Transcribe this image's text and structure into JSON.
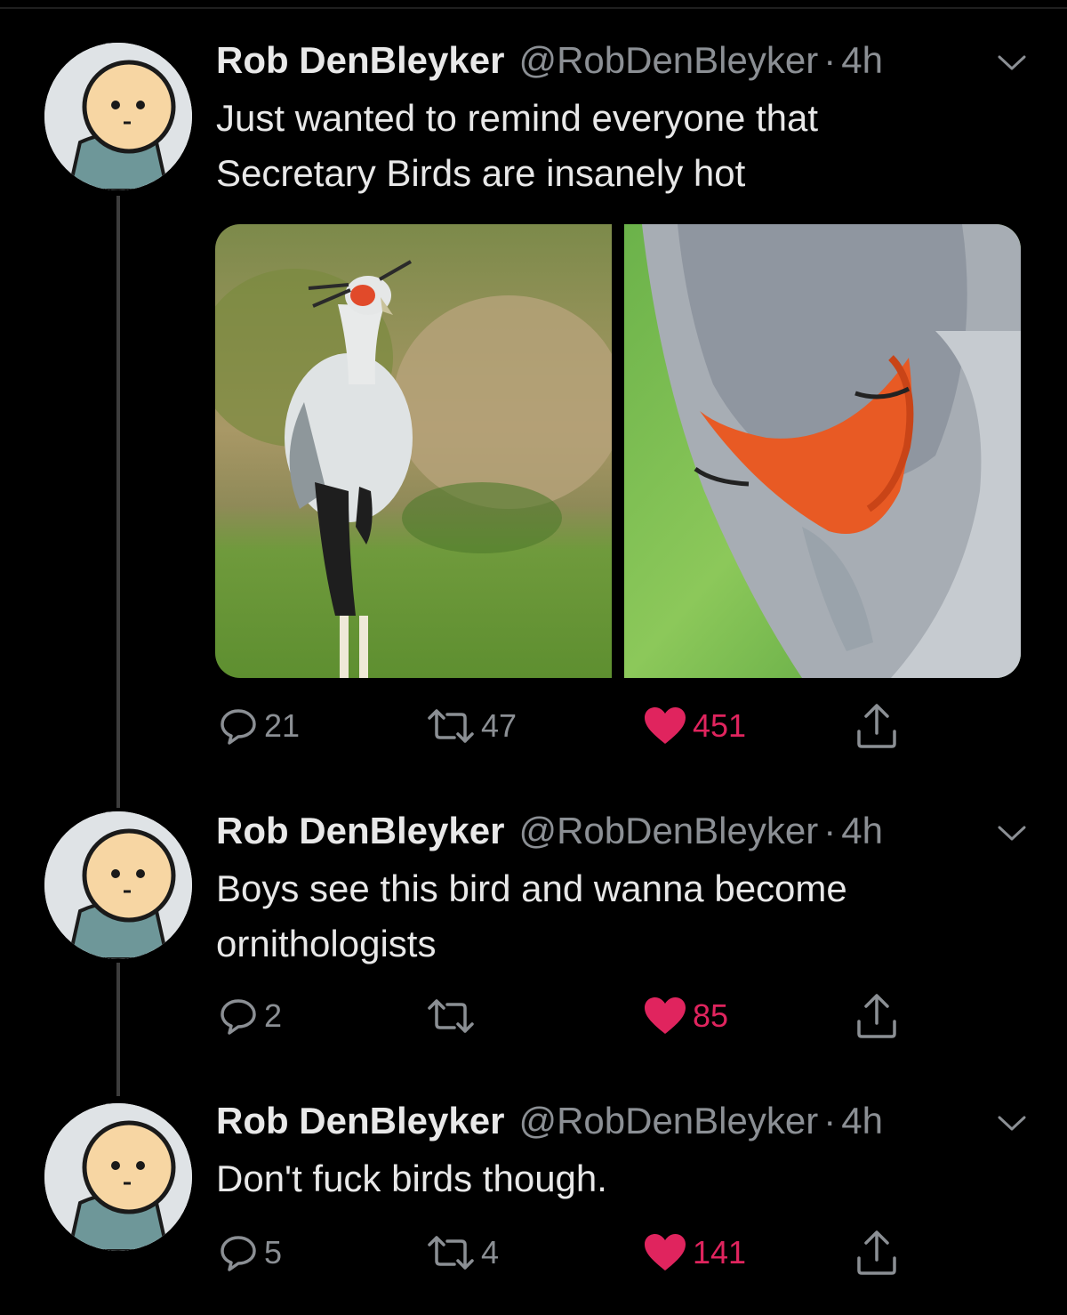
{
  "tweets": [
    {
      "name": "Rob DenBleyker",
      "handle": "@RobDenBleyker",
      "separator": "·",
      "time": "4h",
      "text": "Just wanted to remind everyone that\nSecretary Birds are insanely hot",
      "has_media": true,
      "replies": "21",
      "retweets": "47",
      "likes": "451"
    },
    {
      "name": "Rob DenBleyker",
      "handle": "@RobDenBleyker",
      "separator": "·",
      "time": "4h",
      "text": "Boys see this bird and wanna become\nornithologists",
      "has_media": false,
      "replies": "2",
      "retweets": "",
      "likes": "85"
    },
    {
      "name": "Rob DenBleyker",
      "handle": "@RobDenBleyker",
      "separator": "·",
      "time": "4h",
      "text": "Don't fuck birds though.",
      "has_media": false,
      "replies": "5",
      "retweets": "4",
      "likes": "141"
    }
  ],
  "colors": {
    "background": "#000000",
    "text": "#e8e8e8",
    "muted": "#8b8f94",
    "like": "#e0245e",
    "thread_line": "#3d3d3d"
  },
  "icons": [
    "reply-icon",
    "retweet-icon",
    "heart-icon",
    "share-icon",
    "chevron-down-icon"
  ]
}
